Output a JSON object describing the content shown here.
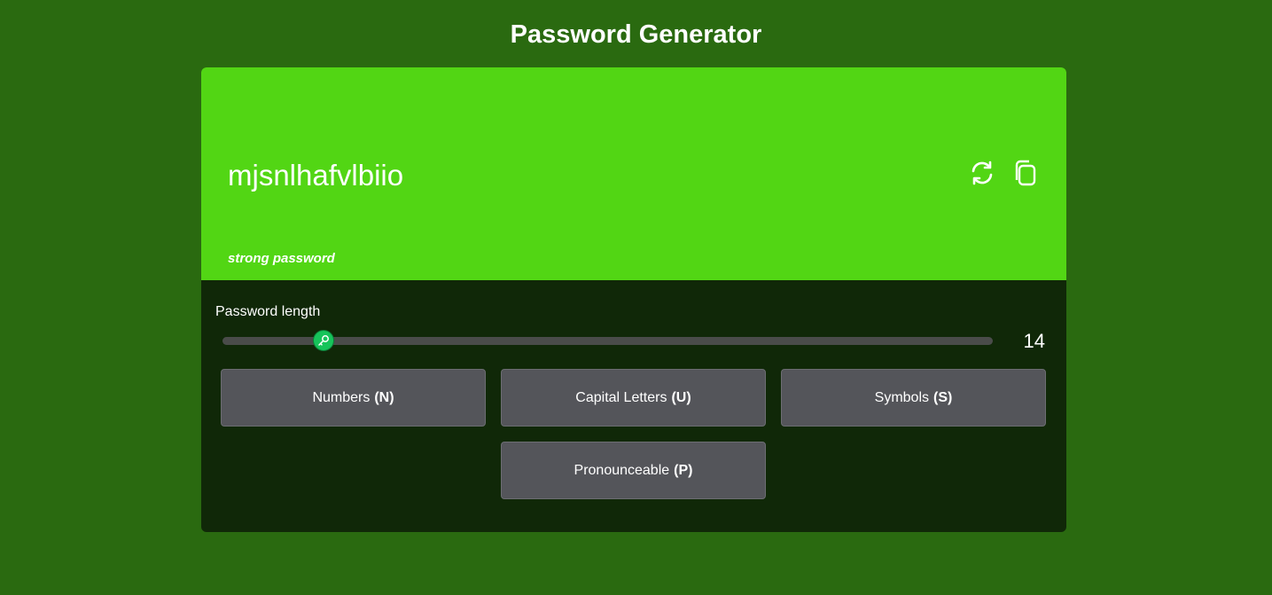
{
  "header": {
    "title": "Password Generator"
  },
  "display": {
    "password": "mjsnlhafvlbiio",
    "strength_label": "strong password",
    "refresh_icon": "refresh-icon",
    "copy_icon": "copy-icon",
    "background_color": "#52d614"
  },
  "length": {
    "label": "Password length",
    "value": "14",
    "slider_min": 1,
    "slider_max": 100,
    "slider_value": 14,
    "thumb_icon": "key-icon",
    "thumb_color": "#16c45a"
  },
  "options": [
    {
      "label": "Numbers",
      "shortcut": "(N)"
    },
    {
      "label": "Capital Letters",
      "shortcut": "(U)"
    },
    {
      "label": "Symbols",
      "shortcut": "(S)"
    },
    {
      "label": "Pronounceable",
      "shortcut": "(P)"
    }
  ],
  "colors": {
    "page_background": "#2a6a10",
    "controls_background": "#102808",
    "option_background": "#54555a"
  }
}
